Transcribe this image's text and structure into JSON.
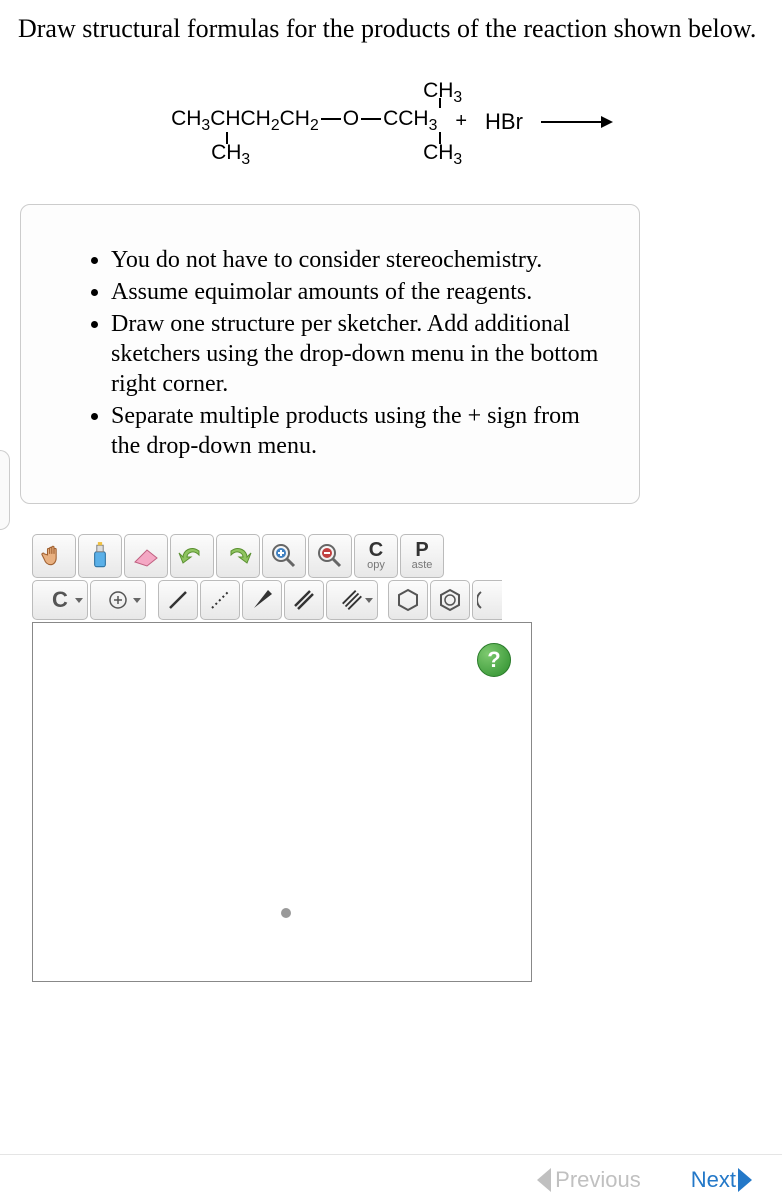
{
  "question": "Draw structural formulas for the products of the reaction shown below.",
  "reaction": {
    "plus": "+",
    "reagent": "HBr"
  },
  "instructions": [
    "You do not have to consider stereochemistry.",
    "Assume equimolar amounts of the reagents.",
    "Draw one structure per sketcher. Add additional sketchers using the drop-down menu in the bottom right corner.",
    "Separate multiple products using the + sign from the drop-down menu."
  ],
  "toolbar": {
    "copy_top": "C",
    "copy_bot": "opy",
    "paste_top": "P",
    "paste_bot": "aste",
    "element_C": "C",
    "help": "?"
  },
  "nav": {
    "previous": "Previous",
    "next": "Next"
  }
}
